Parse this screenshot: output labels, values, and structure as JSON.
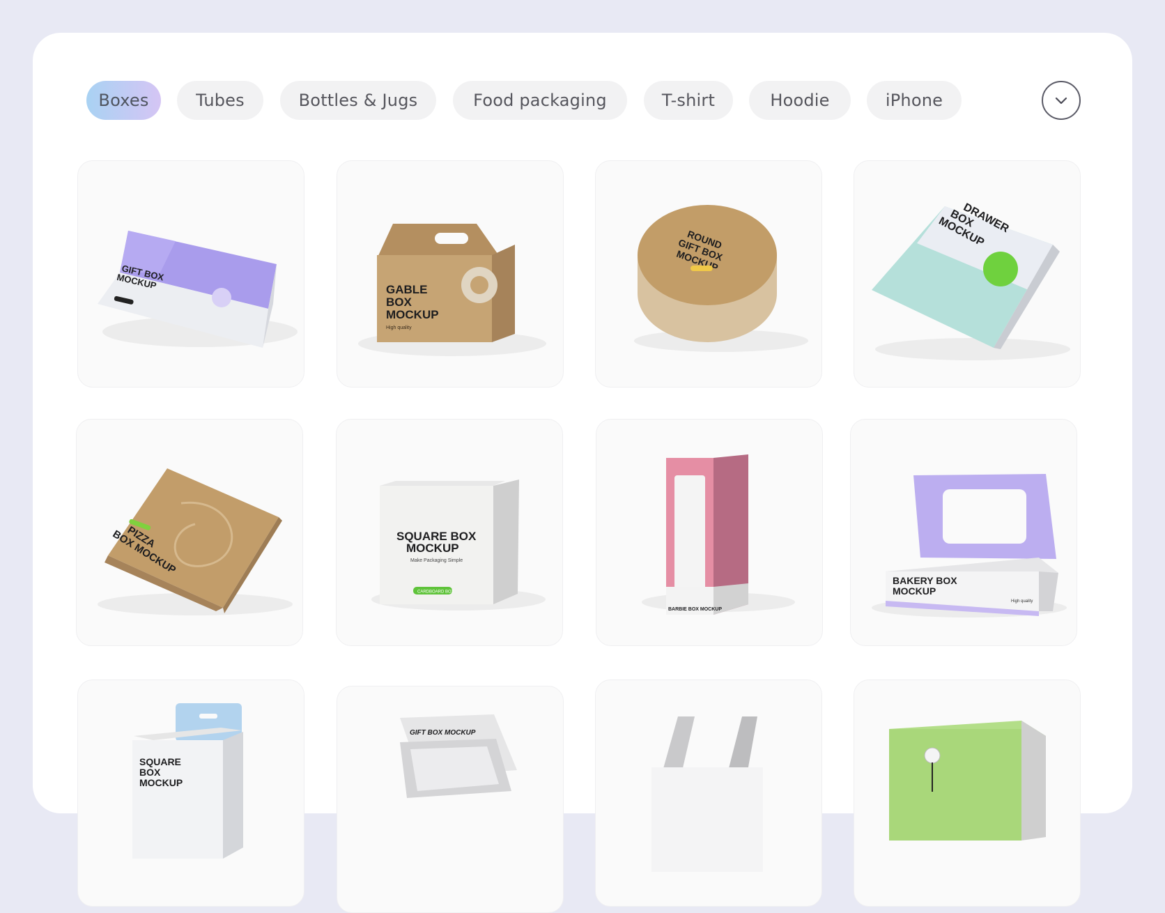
{
  "categories": {
    "items": [
      "Boxes",
      "Tubes",
      "Bottles & Jugs",
      "Food packaging",
      "T-shirt",
      "Hoodie",
      "iPhone"
    ],
    "active": "Boxes",
    "more_icon": "chevron-down-icon"
  },
  "mockups": [
    {
      "name": "gift-box",
      "lines": [
        "GIFT BOX",
        "MOCKUP"
      ],
      "accent": "#a79ae8"
    },
    {
      "name": "gable-box",
      "lines": [
        "GABLE",
        "BOX",
        "MOCKUP"
      ],
      "sub": "High quality",
      "accent": "#c29e6c"
    },
    {
      "name": "round-gift-box",
      "lines": [
        "ROUND",
        "GIFT BOX",
        "MOCKUP"
      ],
      "accent": "#c5a16c"
    },
    {
      "name": "drawer-box",
      "lines": [
        "DRAWER",
        "BOX",
        "MOCKUP"
      ],
      "accent": "#a8dcd6"
    },
    {
      "name": "pizza-box",
      "lines": [
        "PIZZA",
        "BOX MOCKUP"
      ],
      "accent": "#c19e6d"
    },
    {
      "name": "square-box",
      "lines": [
        "SQUARE BOX",
        "MOCKUP"
      ],
      "sub": "Make Packaging Simple",
      "badge": "CARDBOARD BOX",
      "accent": "#eeeeee"
    },
    {
      "name": "barbie-box",
      "lines": [
        "BARBIE BOX MOCKUP"
      ],
      "accent": "#e0899f"
    },
    {
      "name": "bakery-box",
      "lines": [
        "BAKERY BOX",
        "MOCKUP"
      ],
      "sub": "High quality",
      "accent": "#b9a8ec"
    },
    {
      "name": "hanging-square-box",
      "lines": [
        "SQUARE",
        "BOX",
        "MOCKUP"
      ],
      "accent": "#a7c8e6"
    },
    {
      "name": "open-gift-box",
      "lines": [
        "GIFT BOX MOCKUP"
      ],
      "accent": "#dcdcdc"
    },
    {
      "name": "handle-bag-box",
      "lines": [],
      "accent": "#cfcfcf"
    },
    {
      "name": "button-box",
      "lines": [],
      "accent": "#a9d77a"
    }
  ]
}
